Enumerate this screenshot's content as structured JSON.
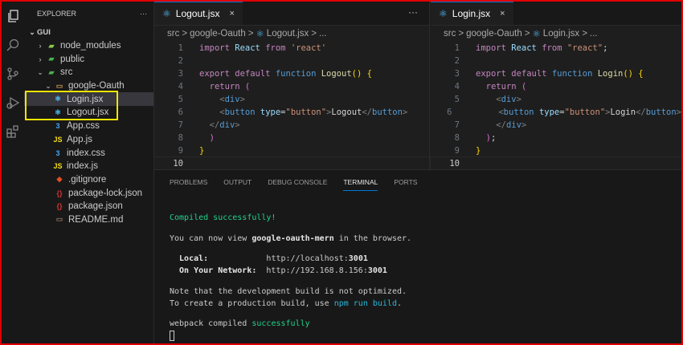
{
  "explorer": {
    "title": "EXPLORER",
    "more": "···",
    "root": "GUI",
    "items": [
      {
        "label": "node_modules",
        "chev": ">",
        "icon": "folder-node",
        "indent": 1
      },
      {
        "label": "public",
        "chev": ">",
        "icon": "folder-public",
        "indent": 1
      },
      {
        "label": "src",
        "chev": "v",
        "icon": "folder-src",
        "indent": 1
      },
      {
        "label": "google-Oauth",
        "chev": "v",
        "icon": "folder",
        "indent": 2
      },
      {
        "label": "Login.jsx",
        "icon": "react",
        "indent": 3,
        "selected": true
      },
      {
        "label": "Logout.jsx",
        "icon": "react",
        "indent": 3
      },
      {
        "label": "App.css",
        "icon": "css",
        "indent": 3
      },
      {
        "label": "App.js",
        "icon": "js",
        "indent": 3
      },
      {
        "label": "index.css",
        "icon": "css",
        "indent": 3
      },
      {
        "label": "index.js",
        "icon": "js",
        "indent": 3
      },
      {
        "label": ".gitignore",
        "icon": "git",
        "indent": 2
      },
      {
        "label": "package-lock.json",
        "icon": "json",
        "indent": 2
      },
      {
        "label": "package.json",
        "icon": "json",
        "indent": 2
      },
      {
        "label": "README.md",
        "icon": "md",
        "indent": 2
      }
    ]
  },
  "editors": [
    {
      "tab": "Logout.jsx",
      "close": "×",
      "more": "···",
      "crumbs": [
        "src",
        ">",
        "google-Oauth",
        ">",
        "Logout.jsx",
        ">",
        "..."
      ],
      "lines": [
        [
          [
            "import ",
            "kw"
          ],
          [
            "React ",
            "id"
          ],
          [
            "from ",
            "kw"
          ],
          [
            "'react'",
            "st"
          ]
        ],
        [],
        [
          [
            "export default ",
            "kw"
          ],
          [
            "function ",
            "fn"
          ],
          [
            "Logout",
            "nm"
          ],
          [
            "() {",
            "br"
          ]
        ],
        [
          [
            "  return ",
            "kw"
          ],
          [
            "(",
            "pr"
          ]
        ],
        [
          [
            "    <",
            "pu"
          ],
          [
            "div",
            "tg"
          ],
          [
            ">",
            "pu"
          ]
        ],
        [
          [
            "    <",
            "pu"
          ],
          [
            "button ",
            "tg"
          ],
          [
            "type",
            "at"
          ],
          [
            "=",
            "tx"
          ],
          [
            "\"button\"",
            "st"
          ],
          [
            ">",
            "pu"
          ],
          [
            "Logout",
            "tx"
          ],
          [
            "</",
            "pu"
          ],
          [
            "button",
            "tg"
          ],
          [
            ">",
            "pu"
          ]
        ],
        [
          [
            "  </",
            "pu"
          ],
          [
            "div",
            "tg"
          ],
          [
            ">",
            "pu"
          ]
        ],
        [
          [
            "  )",
            "pr"
          ]
        ],
        [
          [
            "}",
            "br"
          ]
        ],
        []
      ]
    },
    {
      "tab": "Login.jsx",
      "close": "×",
      "crumbs": [
        "src",
        ">",
        "google-Oauth",
        ">",
        "Login.jsx",
        ">",
        "..."
      ],
      "lines": [
        [
          [
            "import ",
            "kw"
          ],
          [
            "React ",
            "id"
          ],
          [
            "from ",
            "kw"
          ],
          [
            "\"react\"",
            "st"
          ],
          [
            ";",
            "tx"
          ]
        ],
        [],
        [
          [
            "export default ",
            "kw"
          ],
          [
            "function ",
            "fn"
          ],
          [
            "Login",
            "nm"
          ],
          [
            "() {",
            "br"
          ]
        ],
        [
          [
            "  return ",
            "kw"
          ],
          [
            "(",
            "pr"
          ]
        ],
        [
          [
            "    <",
            "pu"
          ],
          [
            "div",
            "tg"
          ],
          [
            ">",
            "pu"
          ]
        ],
        [
          [
            "      <",
            "pu"
          ],
          [
            "button ",
            "tg"
          ],
          [
            "type",
            "at"
          ],
          [
            "=",
            "tx"
          ],
          [
            "\"button\"",
            "st"
          ],
          [
            ">",
            "pu"
          ],
          [
            "Login",
            "tx"
          ],
          [
            "</",
            "pu"
          ],
          [
            "button",
            "tg"
          ],
          [
            ">",
            "pu"
          ]
        ],
        [
          [
            "    </",
            "pu"
          ],
          [
            "div",
            "tg"
          ],
          [
            ">",
            "pu"
          ]
        ],
        [
          [
            "  )",
            "pr"
          ],
          [
            ";",
            "tx"
          ]
        ],
        [
          [
            "}",
            "br"
          ]
        ],
        []
      ]
    }
  ],
  "panel": {
    "tabs": [
      "PROBLEMS",
      "OUTPUT",
      "DEBUG CONSOLE",
      "TERMINAL",
      "PORTS"
    ],
    "active": "TERMINAL",
    "terminal": [
      [
        [
          "Compiled successfully!",
          "g"
        ]
      ],
      null,
      [
        [
          "You can now view ",
          ""
        ],
        [
          "google-oauth-mern",
          "b"
        ],
        [
          " in the browser.",
          ""
        ]
      ],
      null,
      [
        [
          "  Local:",
          "b"
        ],
        [
          "            http://localhost:",
          ""
        ],
        [
          "3001",
          "b"
        ]
      ],
      [
        [
          "  On Your Network:",
          "b"
        ],
        [
          "  http://192.168.8.156:",
          ""
        ],
        [
          "3001",
          "b"
        ]
      ],
      null,
      [
        [
          "Note that the development build is not optimized.",
          ""
        ]
      ],
      [
        [
          "To create a production build, use ",
          ""
        ],
        [
          "npm run build",
          "c"
        ],
        [
          ".",
          ""
        ]
      ],
      null,
      [
        [
          "webpack compiled ",
          ""
        ],
        [
          "successfully",
          "g"
        ]
      ]
    ]
  }
}
